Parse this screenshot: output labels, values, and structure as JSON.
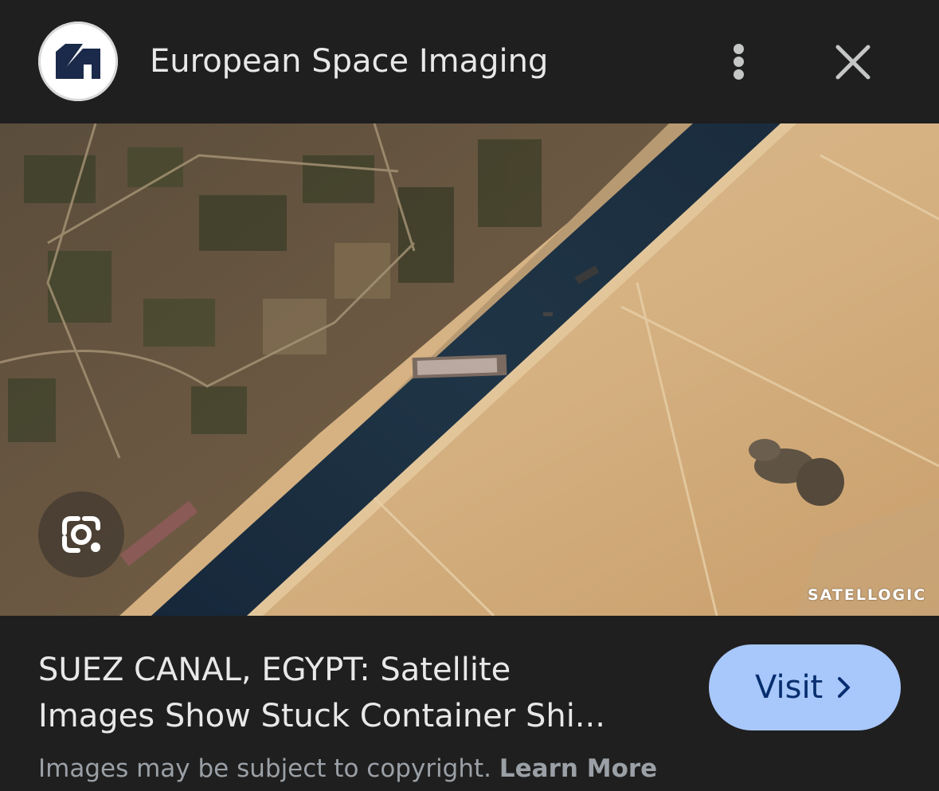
{
  "header": {
    "site_name": "European Space Imaging",
    "logo_icon": "european-space-imaging-logo",
    "more_icon": "more-vert-icon",
    "close_icon": "close-icon"
  },
  "image": {
    "alt": "Satellite image of a container ship stuck in the Suez Canal",
    "watermark": "SATELLOGIC",
    "lens_icon": "google-lens-icon"
  },
  "result": {
    "title_line1": "SUEZ CANAL, EGYPT: Satellite",
    "title_line2": "Images Show Stuck Container Shi...",
    "visit_label": "Visit",
    "visit_icon": "chevron-right-icon",
    "copyright_text": "Images may be subject to copyright.",
    "learn_more": "Learn More"
  },
  "colors": {
    "background": "#1f1f1f",
    "text": "#e8e8e8",
    "muted_text": "#9aa0a6",
    "visit_button": "#a8c7fa",
    "visit_text": "#062e6f",
    "logo_navy": "#1b2a4a"
  }
}
